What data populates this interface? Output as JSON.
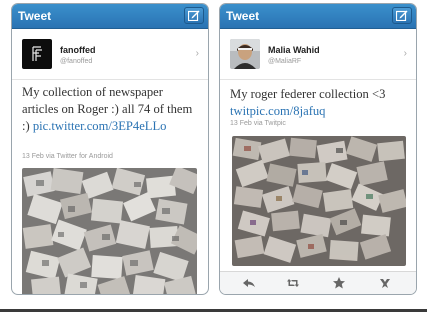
{
  "panels": [
    {
      "header_title": "Tweet",
      "user_name": "fanoffed",
      "user_handle": "@fanoffed",
      "tweet_text": "My collection of newspaper articles on Roger :) all 74 of them :)",
      "tweet_link": "pic.twitter.com/3EP4eLLo",
      "meta": "13 Feb via Twitter for Android"
    },
    {
      "header_title": "Tweet",
      "user_name": "Malia Wahid",
      "user_handle": "@MaliaRF",
      "tweet_text": "My roger federer collection <3",
      "tweet_link": "twitpic.com/8jafuq",
      "meta": "13 Feb via Twitpic"
    }
  ],
  "colors": {
    "header_blue": "#2a73b3",
    "link_blue": "#2a73b3"
  },
  "icons": {
    "compose": "compose-icon",
    "chevron": "chevron-right-icon",
    "actions": [
      "reply-icon",
      "retweet-icon",
      "favorite-star-icon",
      "more-icon"
    ]
  }
}
